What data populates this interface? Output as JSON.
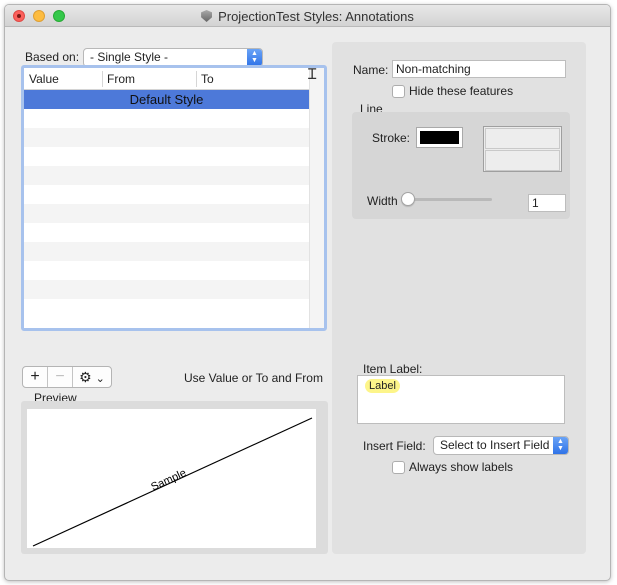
{
  "window": {
    "title": "ProjectionTest Styles: Annotations"
  },
  "left": {
    "based_on_label": "Based on:",
    "based_on_value": "- Single Style -",
    "columns": [
      "Value",
      "From",
      "To"
    ],
    "selected_row": "Default Style",
    "add_symbol": "+",
    "remove_symbol": "−",
    "gear_symbol": "⚙",
    "menu_arrow": "⌄",
    "hint_text": "Use Value or To and From",
    "preview_label": "Preview",
    "sample_text": "Sample"
  },
  "right": {
    "name_label": "Name:",
    "name_value": "Non-matching",
    "hide_label": "Hide these features",
    "line_group_label": "Line",
    "stroke_label": "Stroke:",
    "stroke_color": "#000000",
    "width_label": "Width",
    "width_value": "1",
    "width_slider_fraction": 0,
    "item_label_label": "Item Label:",
    "label_token": "Label",
    "insert_field_label": "Insert Field:",
    "insert_field_value": "Select to Insert Field",
    "always_show_label": "Always show labels"
  },
  "colors": {
    "selection": "#4d79d9",
    "focus_ring": "#a7c2ed",
    "label_chip": "#fdf58a",
    "popup_arrows": "#3a7de9"
  },
  "icons": {
    "close": "close-icon",
    "minimize": "minimize-icon",
    "zoom": "zoom-icon",
    "document": "document-icon",
    "gear": "gear-icon",
    "cursor": "text-cursor-icon"
  }
}
